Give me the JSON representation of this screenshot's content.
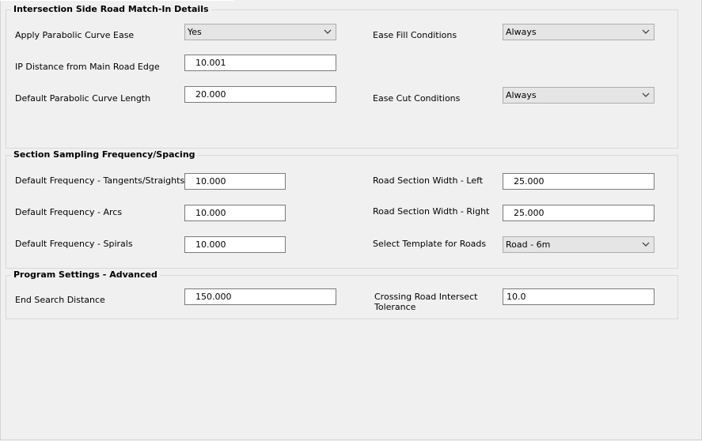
{
  "groups": {
    "intersection": {
      "title": "Intersection Side Road Match-In Details",
      "apply_parabolic_label": "Apply Parabolic Curve Ease",
      "apply_parabolic_value": "Yes",
      "ip_distance_label": "IP Distance from Main Road Edge",
      "ip_distance_value": "10.001",
      "default_parabolic_label": "Default Parabolic Curve Length",
      "default_parabolic_value": "20.000",
      "ease_fill_label": "Ease Fill Conditions",
      "ease_fill_value": "Always",
      "ease_cut_label": "Ease Cut Conditions",
      "ease_cut_value": "Always"
    },
    "sampling": {
      "title": "Section Sampling Frequency/Spacing",
      "freq_tangents_label": "Default Frequency - Tangents/Straights",
      "freq_tangents_value": "10.000",
      "freq_arcs_label": "Default Frequency - Arcs",
      "freq_arcs_value": "10.000",
      "freq_spirals_label": "Default Frequency - Spirals",
      "freq_spirals_value": "10.000",
      "width_left_label": "Road Section Width - Left",
      "width_left_value": "25.000",
      "width_right_label": "Road Section Width - Right",
      "width_right_value": "25.000",
      "template_label": "Select Template for Roads",
      "template_value": "Road - 6m"
    },
    "advanced": {
      "title": "Program Settings - Advanced",
      "end_search_label": "End Search Distance",
      "end_search_value": "150.000",
      "crossing_label": "Crossing Road Intersect Tolerance",
      "crossing_value": "10.0"
    }
  }
}
